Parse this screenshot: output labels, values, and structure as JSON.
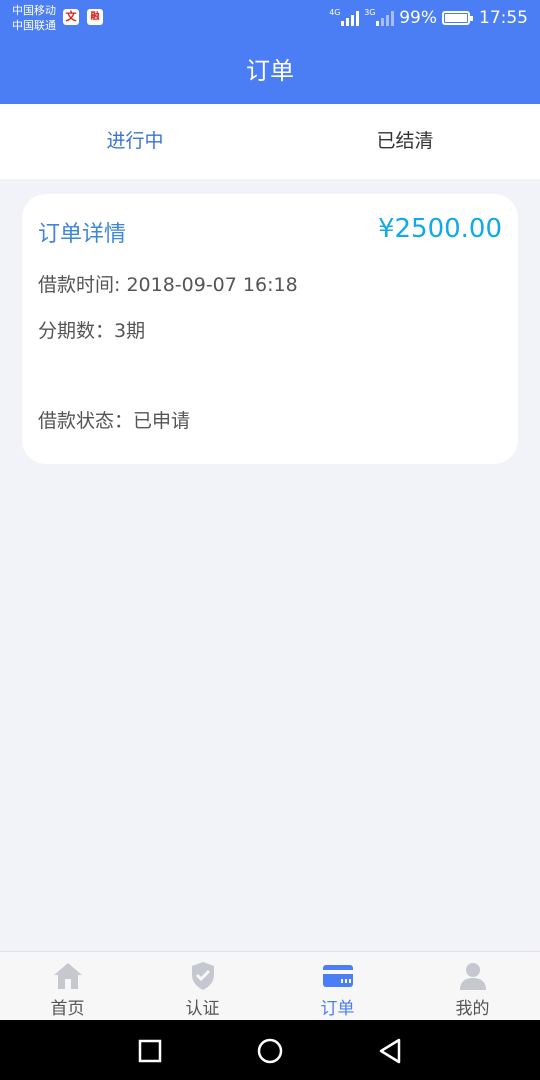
{
  "status_bar": {
    "carrier_1": "中国移动",
    "carrier_2": "中国联通",
    "app_icon_1": "文",
    "app_icon_2": "融",
    "network_1": "4G",
    "network_2": "3G",
    "battery": "99%",
    "time": "17:55"
  },
  "header": {
    "title": "订单"
  },
  "tabs": [
    {
      "label": "进行中",
      "active": true
    },
    {
      "label": "已结清",
      "active": false
    }
  ],
  "order_card": {
    "title": "订单详情",
    "amount": "¥2500.00",
    "loan_time": "借款时间: 2018-09-07 16:18",
    "installments": "分期数：3期",
    "loan_status": "借款状态：已申请"
  },
  "bottom_nav": [
    {
      "label": "首页",
      "icon": "home-icon",
      "active": false
    },
    {
      "label": "认证",
      "icon": "shield-check-icon",
      "active": false
    },
    {
      "label": "订单",
      "icon": "card-icon",
      "active": true
    },
    {
      "label": "我的",
      "icon": "user-icon",
      "active": false
    }
  ],
  "colors": {
    "primary": "#4b7ef4",
    "tab_active": "#3d72d7",
    "card_title": "#3d86d8",
    "amount": "#11a9e9",
    "background": "#f1f3f8"
  }
}
